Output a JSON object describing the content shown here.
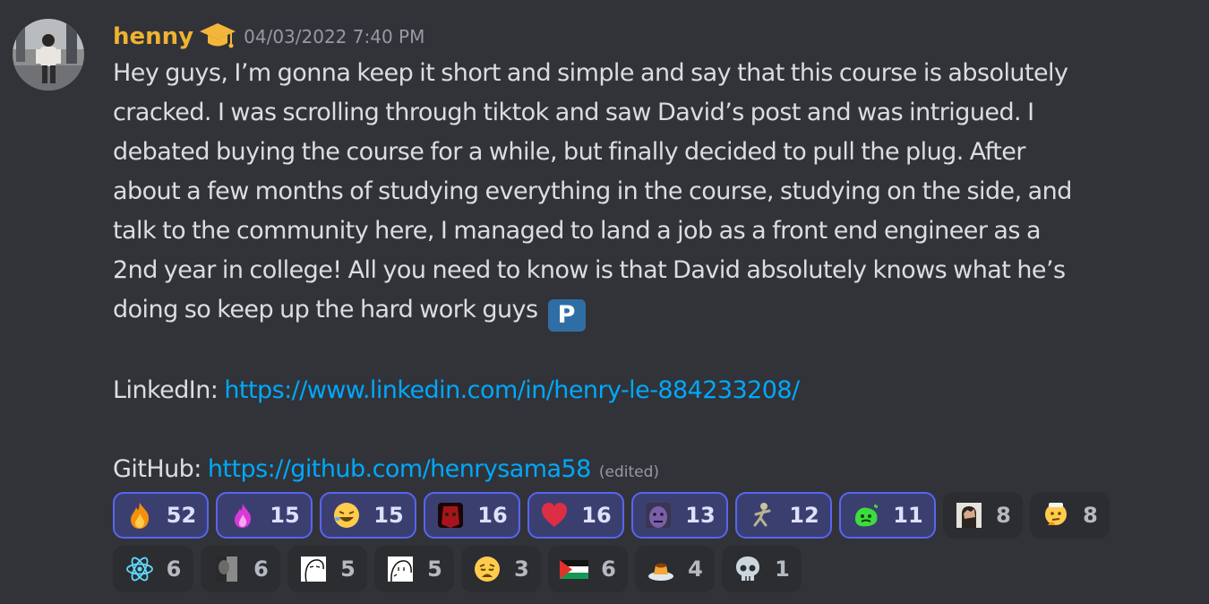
{
  "message": {
    "username": "henny",
    "timestamp": "04/03/2022 7:40 PM",
    "avatar_icon": "user-photo-avatar",
    "badge_icon": "graduation-cap-icon",
    "lines": [
      "Hey guys, I’m gonna keep it short and simple and say that this course is absolutely",
      "cracked. I was scrolling through tiktok and saw David’s post and was intrigued. I",
      "debated buying the course for a while, but finally decided to pull the plug. After",
      "about a few months of studying everything in the course, studying on the side, and",
      "talk to the community here, I managed to land a job as a front end engineer as a",
      "2nd year in college! All you need to know is that David absolutely knows what he’s",
      "doing so keep up the hard work guys"
    ],
    "p_emoji": "P",
    "linkedin_label": "LinkedIn:",
    "linkedin_url": "https://www.linkedin.com/in/henry-le-884233208/",
    "github_label": "GitHub:",
    "github_url": "https://github.com/henrysama58",
    "edited": "(edited)"
  },
  "colors": {
    "background": "#313338",
    "username": "#f0b232",
    "link": "#00a8fc",
    "reaction_active_border": "#5865f2"
  },
  "reactions": {
    "row1": [
      {
        "icon": "fire-icon",
        "count": "52"
      },
      {
        "icon": "pink-flame-icon",
        "count": "15"
      },
      {
        "icon": "laughing-face-icon",
        "count": "15"
      },
      {
        "icon": "red-mask-icon",
        "count": "16"
      },
      {
        "icon": "heart-icon",
        "count": "16"
      },
      {
        "icon": "purple-face-icon",
        "count": "13"
      },
      {
        "icon": "dancing-figure-icon",
        "count": "12"
      },
      {
        "icon": "green-blob-icon",
        "count": "11"
      },
      {
        "icon": "facepalm-photo-icon",
        "count": "8"
      },
      {
        "icon": "thinking-face-icon",
        "count": "8"
      }
    ],
    "row2": [
      {
        "icon": "react-logo-icon",
        "count": "6"
      },
      {
        "icon": "dark-photo-icon",
        "count": "6"
      },
      {
        "icon": "meme-sketch-icon",
        "count": "5"
      },
      {
        "icon": "meme-sketch-2-icon",
        "count": "5"
      },
      {
        "icon": "weary-face-icon",
        "count": "3"
      },
      {
        "icon": "palestine-flag-icon",
        "count": "6"
      },
      {
        "icon": "pudding-icon",
        "count": "4"
      },
      {
        "icon": "skull-icon",
        "count": "1"
      }
    ]
  }
}
